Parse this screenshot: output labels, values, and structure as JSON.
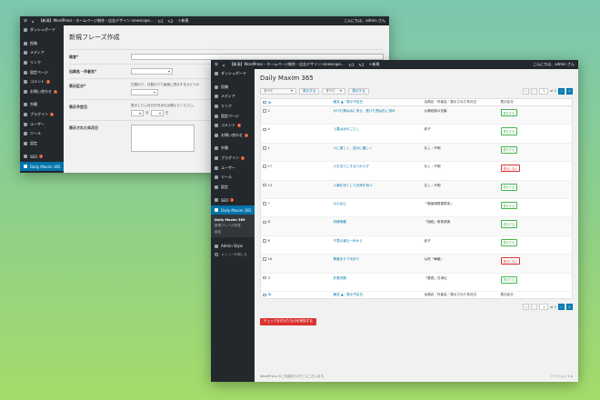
{
  "admin_bar": {
    "site_name": "【新潟】WordPress・ホームページ制作・広告デザイン ninescope...",
    "updates": "1",
    "comments": "2",
    "new_label": "新規",
    "greeting": "こんにちは、admin さん"
  },
  "back_window": {
    "page_title": "新規フレーズ作成",
    "menu": [
      {
        "label": "ダッシュボード"
      },
      {
        "label": "投稿"
      },
      {
        "label": "メディア"
      },
      {
        "label": "リンク"
      },
      {
        "label": "固定ページ"
      },
      {
        "label": "コメント",
        "badge": "2"
      },
      {
        "label": "お問い合わせ",
        "badge": "1"
      },
      {
        "label": "外観"
      },
      {
        "label": "プラグイン",
        "badge": "1"
      },
      {
        "label": "ユーザー"
      },
      {
        "label": "ツール"
      },
      {
        "label": "設定"
      },
      {
        "label": "SEO",
        "badge": "1"
      },
      {
        "label": "Daily Maxim 365"
      }
    ],
    "form": {
      "maxim_label": "格言*",
      "source_label": "出典名・作者名*",
      "status_label": "表示区分*",
      "status_help": "日替わり、月替わりで画面に表示するかどうか",
      "schedule_label": "表示予定日",
      "schedule_help": "表示したい月日が決まれば選んでください。",
      "month_unit": "月",
      "day_unit": "日",
      "year_label": "表示された年月日"
    }
  },
  "front_window": {
    "page_title": "Daily Maxim 365",
    "menu": [
      {
        "label": "ダッシュボード"
      },
      {
        "label": "投稿"
      },
      {
        "label": "メディア"
      },
      {
        "label": "リンク"
      },
      {
        "label": "固定ページ"
      },
      {
        "label": "コメント",
        "badge": "2"
      },
      {
        "label": "お問い合わせ",
        "badge": "1"
      },
      {
        "label": "外観"
      },
      {
        "label": "プラグイン",
        "badge": "1"
      },
      {
        "label": "ユーザー"
      },
      {
        "label": "ツール"
      },
      {
        "label": "設定"
      },
      {
        "label": "SEO",
        "badge": "1"
      },
      {
        "label": "Daily Maxim 365"
      }
    ],
    "submenu": [
      "Daily Maxim 365",
      "新規フレーズ作成",
      "設定"
    ],
    "extra_menu": "Admin Style",
    "collapse_label": "メニューを閉じる",
    "filter1": "すべて",
    "filter1_button": "表示する",
    "filter2": "すべて",
    "filter2_button": "表示する",
    "pagination": {
      "current": "1",
      "total_label": "of 2"
    },
    "columns": {
      "id": "ID",
      "maxim": "格言 ▲／表示予定日",
      "source": "出典名・作者名／表示された年月日",
      "status": "表示区分"
    },
    "rows": [
      {
        "id": "2",
        "maxim": "かけた情は水に流せ、受けた恩は石に刻め",
        "source": "仏教経典の言葉",
        "status": "表示する",
        "on": true
      },
      {
        "id": "4",
        "maxim": "上善は水のごとし",
        "source": "老子",
        "status": "表示する",
        "on": true
      },
      {
        "id": "1",
        "maxim": "人に優しく、自分に厳しく",
        "source": "なし・不明",
        "status": "表示する",
        "on": true
      },
      {
        "id": "17",
        "maxim": "人を当てにするべからず",
        "source": "なし・不明",
        "status": "表示しない",
        "on": false
      },
      {
        "id": "13",
        "maxim": "人事を尽くして天命を待つ",
        "source": "なし・不明",
        "status": "表示する",
        "on": true
      },
      {
        "id": "7",
        "maxim": "以心伝心",
        "source": "「無論頌是善提序」",
        "status": "表示する",
        "on": true
      },
      {
        "id": "8",
        "maxim": "切磋琢磨",
        "source": "『詩経』衛風淇奥",
        "status": "表示する",
        "on": true
      },
      {
        "id": "6",
        "maxim": "千里の道も一歩から",
        "source": "老子",
        "status": "表示する",
        "on": true
      },
      {
        "id": "16",
        "maxim": "節度ありて河あり",
        "source": "仏陀『華厳』",
        "status": "表示しない",
        "on": false
      },
      {
        "id": "3",
        "maxim": "外柔内剛",
        "source": "「晋書」甘卓伝",
        "status": "表示する",
        "on": true
      }
    ],
    "bulk_delete": "チェックを付けたものを削除する",
    "footer_left": "WordPress のご利用ありがとうございます。",
    "footer_right": "バージョン 5.4"
  }
}
